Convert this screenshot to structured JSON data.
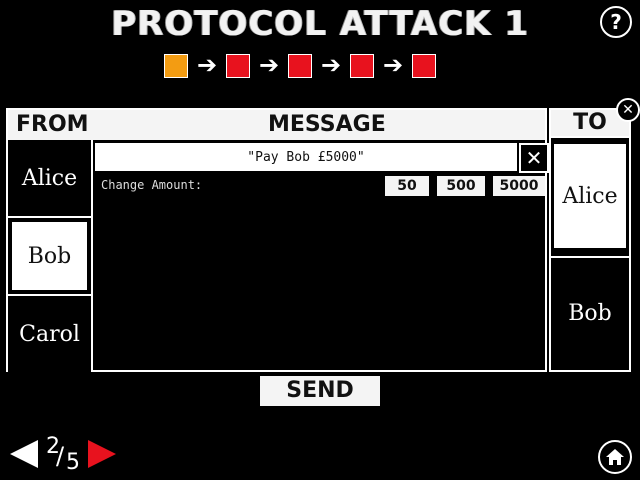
{
  "title": "PROTOCOL ATTACK 1",
  "help_icon": "question-icon",
  "progress": {
    "steps": [
      {
        "state": "current",
        "color": "#f39c12"
      },
      {
        "state": "locked",
        "color": "#e8121e"
      },
      {
        "state": "locked",
        "color": "#e8121e"
      },
      {
        "state": "locked",
        "color": "#e8121e"
      },
      {
        "state": "locked",
        "color": "#e8121e"
      }
    ],
    "arrow": "➔"
  },
  "headers": {
    "from": "FROM",
    "message": "MESSAGE",
    "to": "TO"
  },
  "senders": [
    {
      "name": "Alice",
      "selected": false
    },
    {
      "name": "Bob",
      "selected": true
    },
    {
      "name": "Carol",
      "selected": false
    }
  ],
  "message": {
    "text": "\"Pay Bob £5000\"",
    "close_label": "✕",
    "change_label": "Change Amount:",
    "amounts": [
      "50",
      "500",
      "5000"
    ]
  },
  "recipients": [
    {
      "name": "Alice",
      "selected": true
    },
    {
      "name": "Bob",
      "selected": false
    }
  ],
  "panel_close": "✕",
  "send_label": "SEND",
  "pagination": {
    "current": "2",
    "total": "5"
  },
  "home_icon": "home-icon"
}
